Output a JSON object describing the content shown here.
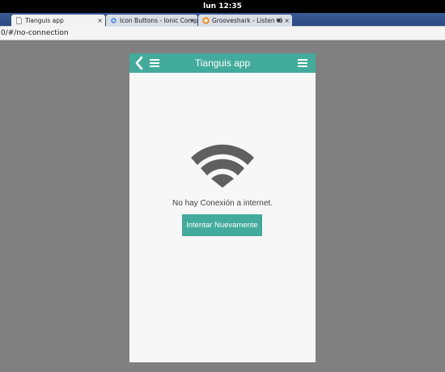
{
  "system": {
    "clock": "lun 12:35"
  },
  "browser": {
    "tabs": [
      {
        "label": "Tianguis app",
        "active": true
      },
      {
        "label": "Icon Buttons - Ionic Compo",
        "active": false
      },
      {
        "label": "Grooveshark - Listen to",
        "active": false
      }
    ],
    "address": "0/#/no-connection"
  },
  "app": {
    "title": "Tianguis app",
    "message": "No hay Conexión a internet.",
    "retry_label": "Intentar Nuevamente",
    "accent_color": "#43ab9b",
    "icons": [
      "back-icon",
      "menu-icon",
      "wifi-icon"
    ]
  }
}
